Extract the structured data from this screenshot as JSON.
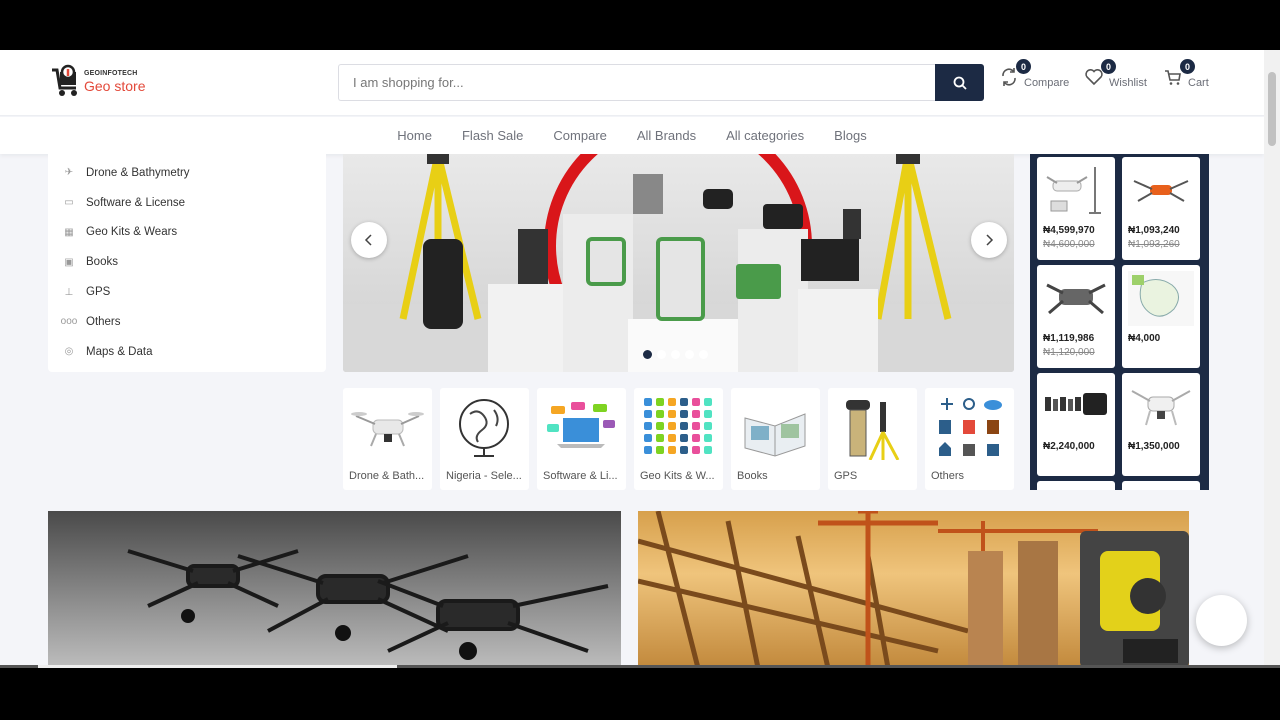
{
  "brand": {
    "small": "GEOINFOTECH",
    "name": "Geo store"
  },
  "search": {
    "placeholder": "I am shopping for..."
  },
  "header": {
    "compare": {
      "label": "Compare",
      "count": "0"
    },
    "wishlist": {
      "label": "Wishlist",
      "count": "0"
    },
    "cart": {
      "label": "Cart",
      "count": "0"
    }
  },
  "nav": [
    "Home",
    "Flash Sale",
    "Compare",
    "All Brands",
    "All categories",
    "Blogs"
  ],
  "categories": [
    {
      "label": "Drone & Bathymetry",
      "icon": "drone-icon"
    },
    {
      "label": "Software & License",
      "icon": "laptop-icon"
    },
    {
      "label": "Geo Kits & Wears",
      "icon": "grid-icon"
    },
    {
      "label": "Books",
      "icon": "book-icon"
    },
    {
      "label": "GPS",
      "icon": "gps-icon"
    },
    {
      "label": "Others",
      "icon": "dots-icon"
    },
    {
      "label": "Maps & Data",
      "icon": "globe-icon"
    }
  ],
  "slider": {
    "total": 5,
    "active": 0
  },
  "tiles": [
    "Drone & Bath...",
    "Nigeria - Sele...",
    "Software & Li...",
    "Geo Kits & W...",
    "Books",
    "GPS",
    "Others"
  ],
  "deals": [
    {
      "price": "₦4,599,970",
      "old": "₦4,600,000"
    },
    {
      "price": "₦1,093,240",
      "old": "₦1,093,260"
    },
    {
      "price": "₦1,119,986",
      "old": "₦1,120,000"
    },
    {
      "price": "₦4,000",
      "old": ""
    },
    {
      "price": "₦2,240,000",
      "old": ""
    },
    {
      "price": "₦1,350,000",
      "old": ""
    }
  ],
  "colors": {
    "primary": "#1c2a44",
    "accent": "#e3493a",
    "background": "#f4f5f9"
  }
}
